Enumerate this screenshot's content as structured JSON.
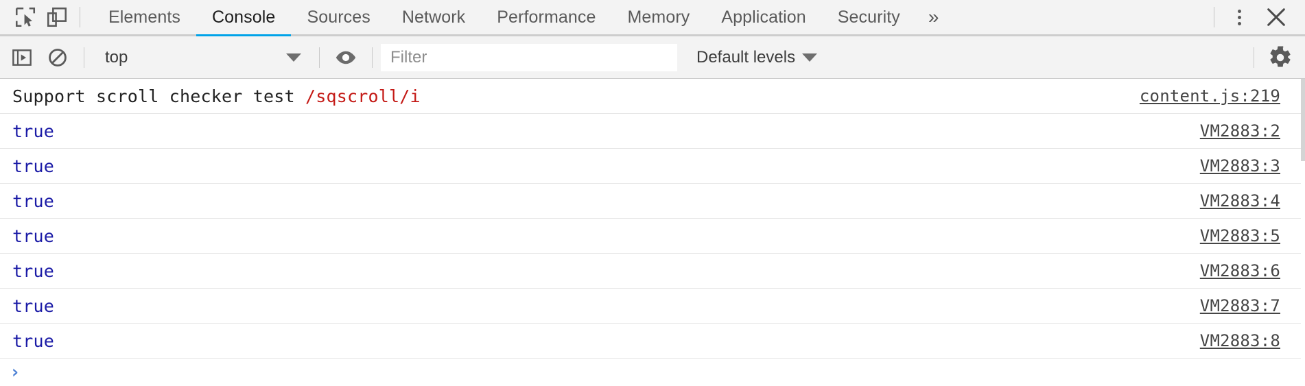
{
  "window": {
    "title": "DevTools - Console"
  },
  "tabbar": {
    "inspect_icon": "inspect-element-icon",
    "device_icon": "device-toolbar-icon",
    "tabs": [
      {
        "label": "Elements",
        "active": false
      },
      {
        "label": "Console",
        "active": true
      },
      {
        "label": "Sources",
        "active": false
      },
      {
        "label": "Network",
        "active": false
      },
      {
        "label": "Performance",
        "active": false
      },
      {
        "label": "Memory",
        "active": false
      },
      {
        "label": "Application",
        "active": false
      },
      {
        "label": "Security",
        "active": false
      }
    ],
    "overflow_label": "»",
    "menu_icon": "kebab-menu-icon",
    "close_icon": "close-icon",
    "active_underline_color": "#00a2e8"
  },
  "toolbar": {
    "sidebar_toggle_icon": "console-sidebar-icon",
    "clear_console_icon": "clear-console-icon",
    "context": {
      "value": "top",
      "caret_icon": "chevron-down-icon"
    },
    "live_expression_icon": "eye-icon",
    "filter": {
      "value": "",
      "placeholder": "Filter"
    },
    "levels": {
      "value": "Default levels",
      "caret_icon": "chevron-down-icon"
    },
    "settings_icon": "gear-icon"
  },
  "console": {
    "messages": [
      {
        "text": "Support scroll checker test ",
        "regex": "/sqscroll/i",
        "type": "log",
        "source": "content.js:219"
      },
      {
        "text": "true",
        "type": "boolean",
        "source": "VM2883:2"
      },
      {
        "text": "true",
        "type": "boolean",
        "source": "VM2883:3"
      },
      {
        "text": "true",
        "type": "boolean",
        "source": "VM2883:4"
      },
      {
        "text": "true",
        "type": "boolean",
        "source": "VM2883:5"
      },
      {
        "text": "true",
        "type": "boolean",
        "source": "VM2883:6"
      },
      {
        "text": "true",
        "type": "boolean",
        "source": "VM2883:7"
      },
      {
        "text": "true",
        "type": "boolean",
        "source": "VM2883:8"
      }
    ],
    "prompt_symbol": "›"
  },
  "colors": {
    "accent": "#00a2e8",
    "boolean": "#1a1aa6",
    "regex": "#c41a16",
    "chrome_bg": "#f3f3f3",
    "link": "#454545"
  }
}
